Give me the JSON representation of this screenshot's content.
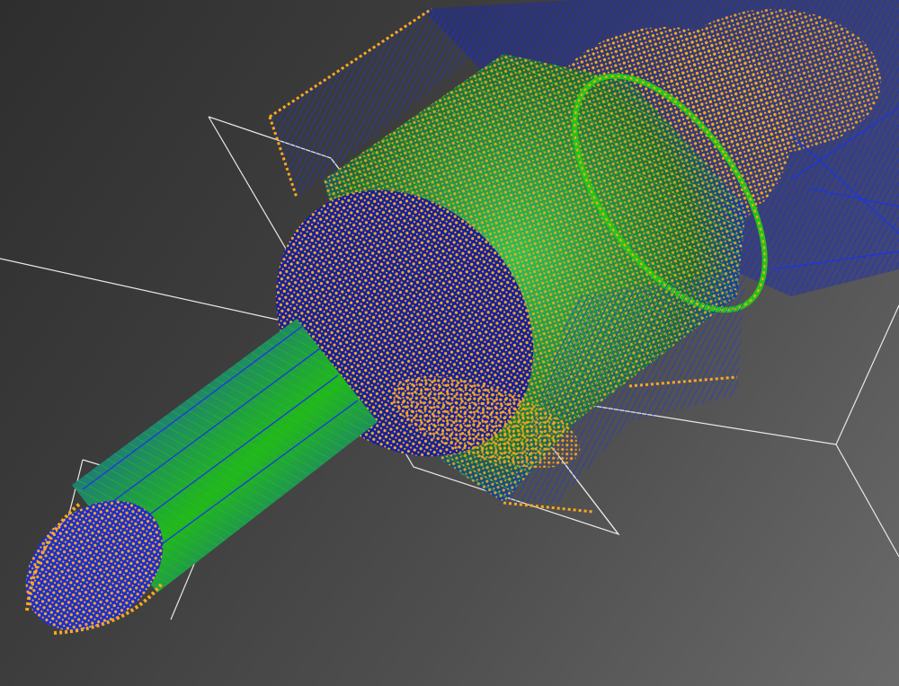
{
  "viewport": {
    "background_dark": "#2e2e2e",
    "background_light": "#6a6a6a"
  },
  "colors": {
    "wire_blue": "#1a35e6",
    "wire_green": "#26c41a",
    "point_orange": "#ffa91c",
    "guide_white": "#e8e8e8"
  },
  "scene": {
    "description_icon": "wireframe-3d-model-icon",
    "parts": [
      "tip-cone",
      "shaft",
      "hub-cone",
      "drum",
      "gear-ring",
      "rear-housing"
    ]
  }
}
